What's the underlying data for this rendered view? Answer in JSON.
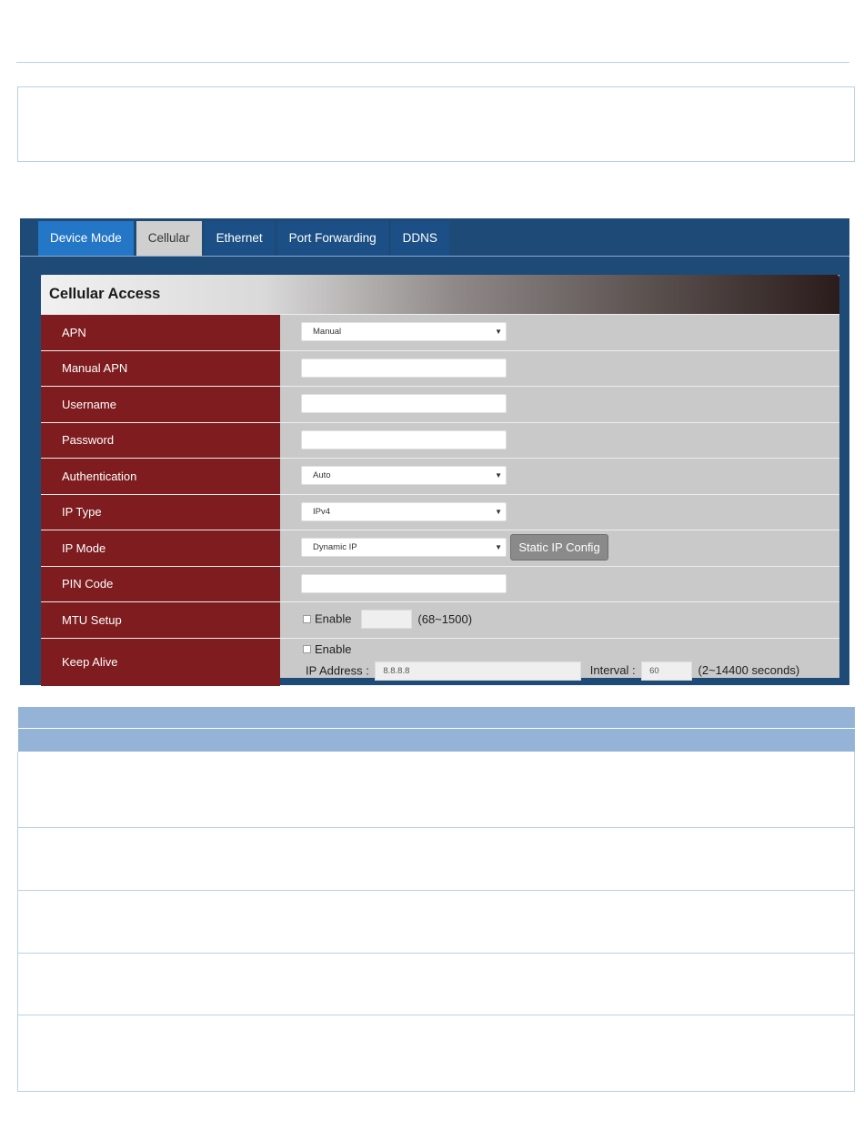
{
  "tabs": [
    {
      "label": "Device Mode"
    },
    {
      "label": "Cellular"
    },
    {
      "label": "Ethernet"
    },
    {
      "label": "Port Forwarding"
    },
    {
      "label": "DDNS"
    }
  ],
  "active_tab": "Cellular",
  "card_title": "Cellular Access",
  "rows": {
    "apn": {
      "label": "APN",
      "value": "Manual"
    },
    "manual_apn": {
      "label": "Manual APN",
      "value": ""
    },
    "username": {
      "label": "Username",
      "value": ""
    },
    "password": {
      "label": "Password",
      "value": ""
    },
    "authentication": {
      "label": "Authentication",
      "value": "Auto"
    },
    "ip_type": {
      "label": "IP Type",
      "value": "IPv4"
    },
    "ip_mode": {
      "label": "IP Mode",
      "value": "Dynamic IP",
      "button": "Static IP Config"
    },
    "pin_code": {
      "label": "PIN Code",
      "value": ""
    },
    "mtu_setup": {
      "label": "MTU Setup",
      "enable": "Enable",
      "value": "",
      "range": "(68~1500)"
    },
    "keep_alive": {
      "label": "Keep Alive",
      "enable": "Enable",
      "ip_label": "IP Address :",
      "ip_value": "8.8.8.8",
      "interval_label": "Interval :",
      "interval_value": "60",
      "interval_range": "(2~14400 seconds)"
    }
  },
  "colors": {
    "panel_bg": "#1e4a78",
    "tab_bg": "#1b4f85",
    "tab_first_bg": "#2476c7",
    "tab_active_bg": "#cfcfcf",
    "label_bg": "#7e1c1f",
    "value_bg": "#c9c9c9",
    "table_header": "#95b3d7"
  }
}
